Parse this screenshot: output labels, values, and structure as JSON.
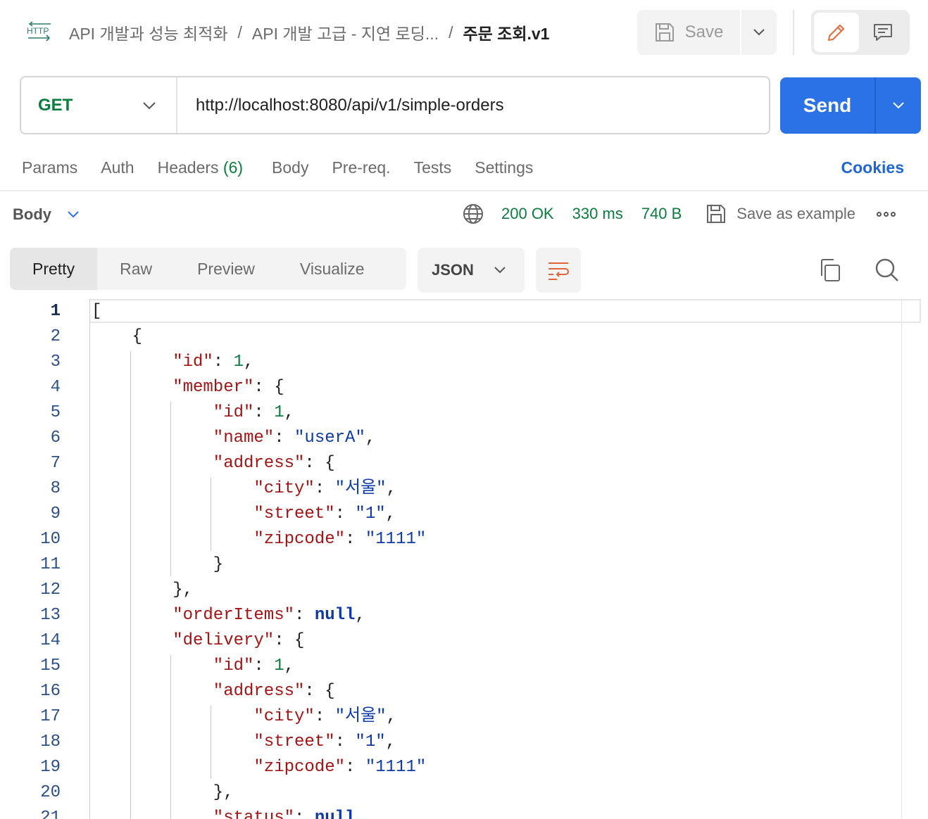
{
  "header": {
    "protocol_icon": "http-icon",
    "breadcrumbs": [
      "API 개발과 성능 최적화",
      "API 개발 고급 - 지연 로딩..."
    ],
    "separator": "/",
    "current": "주문 조회.v1",
    "save_label": "Save"
  },
  "request": {
    "method": "GET",
    "url": "http://localhost:8080/api/v1/simple-orders",
    "send_label": "Send"
  },
  "request_tabs": {
    "params": "Params",
    "auth": "Auth",
    "headers": "Headers",
    "headers_count": "(6)",
    "body": "Body",
    "prereq": "Pre-req.",
    "tests": "Tests",
    "settings": "Settings",
    "cookies": "Cookies"
  },
  "response": {
    "section_label": "Body",
    "status": "200 OK",
    "time": "330 ms",
    "size": "740 B",
    "save_example_label": "Save as example",
    "view_tabs": [
      "Pretty",
      "Raw",
      "Preview",
      "Visualize"
    ],
    "active_view": "Pretty",
    "format": "JSON"
  },
  "colors": {
    "accent_blue": "#2b72e6",
    "method_green": "#0b7d3e",
    "json_key": "#a31515",
    "json_string": "#0d3aa8",
    "json_number": "#0b7d3e"
  },
  "code_lines": [
    {
      "n": "1",
      "indent": 0,
      "parts": [
        [
          "p",
          "["
        ]
      ]
    },
    {
      "n": "2",
      "indent": 1,
      "parts": [
        [
          "p",
          "{"
        ]
      ]
    },
    {
      "n": "3",
      "indent": 2,
      "parts": [
        [
          "k",
          "\"id\""
        ],
        [
          "p",
          ": "
        ],
        [
          "n",
          "1"
        ],
        [
          "p",
          ","
        ]
      ]
    },
    {
      "n": "4",
      "indent": 2,
      "parts": [
        [
          "k",
          "\"member\""
        ],
        [
          "p",
          ": {"
        ]
      ]
    },
    {
      "n": "5",
      "indent": 3,
      "parts": [
        [
          "k",
          "\"id\""
        ],
        [
          "p",
          ": "
        ],
        [
          "n",
          "1"
        ],
        [
          "p",
          ","
        ]
      ]
    },
    {
      "n": "6",
      "indent": 3,
      "parts": [
        [
          "k",
          "\"name\""
        ],
        [
          "p",
          ": "
        ],
        [
          "s",
          "\"userA\""
        ],
        [
          "p",
          ","
        ]
      ]
    },
    {
      "n": "7",
      "indent": 3,
      "parts": [
        [
          "k",
          "\"address\""
        ],
        [
          "p",
          ": {"
        ]
      ]
    },
    {
      "n": "8",
      "indent": 4,
      "parts": [
        [
          "k",
          "\"city\""
        ],
        [
          "p",
          ": "
        ],
        [
          "s",
          "\"서울\""
        ],
        [
          "p",
          ","
        ]
      ]
    },
    {
      "n": "9",
      "indent": 4,
      "parts": [
        [
          "k",
          "\"street\""
        ],
        [
          "p",
          ": "
        ],
        [
          "s",
          "\"1\""
        ],
        [
          "p",
          ","
        ]
      ]
    },
    {
      "n": "10",
      "indent": 4,
      "parts": [
        [
          "k",
          "\"zipcode\""
        ],
        [
          "p",
          ": "
        ],
        [
          "s",
          "\"1111\""
        ]
      ]
    },
    {
      "n": "11",
      "indent": 3,
      "parts": [
        [
          "p",
          "}"
        ]
      ]
    },
    {
      "n": "12",
      "indent": 2,
      "parts": [
        [
          "p",
          "},"
        ]
      ]
    },
    {
      "n": "13",
      "indent": 2,
      "parts": [
        [
          "k",
          "\"orderItems\""
        ],
        [
          "p",
          ": "
        ],
        [
          "nl",
          "null"
        ],
        [
          "p",
          ","
        ]
      ]
    },
    {
      "n": "14",
      "indent": 2,
      "parts": [
        [
          "k",
          "\"delivery\""
        ],
        [
          "p",
          ": {"
        ]
      ]
    },
    {
      "n": "15",
      "indent": 3,
      "parts": [
        [
          "k",
          "\"id\""
        ],
        [
          "p",
          ": "
        ],
        [
          "n",
          "1"
        ],
        [
          "p",
          ","
        ]
      ]
    },
    {
      "n": "16",
      "indent": 3,
      "parts": [
        [
          "k",
          "\"address\""
        ],
        [
          "p",
          ": {"
        ]
      ]
    },
    {
      "n": "17",
      "indent": 4,
      "parts": [
        [
          "k",
          "\"city\""
        ],
        [
          "p",
          ": "
        ],
        [
          "s",
          "\"서울\""
        ],
        [
          "p",
          ","
        ]
      ]
    },
    {
      "n": "18",
      "indent": 4,
      "parts": [
        [
          "k",
          "\"street\""
        ],
        [
          "p",
          ": "
        ],
        [
          "s",
          "\"1\""
        ],
        [
          "p",
          ","
        ]
      ]
    },
    {
      "n": "19",
      "indent": 4,
      "parts": [
        [
          "k",
          "\"zipcode\""
        ],
        [
          "p",
          ": "
        ],
        [
          "s",
          "\"1111\""
        ]
      ]
    },
    {
      "n": "20",
      "indent": 3,
      "parts": [
        [
          "p",
          "},"
        ]
      ]
    },
    {
      "n": "21",
      "indent": 3,
      "parts": [
        [
          "k",
          "\"status\""
        ],
        [
          "p",
          ": "
        ],
        [
          "nl",
          "null"
        ]
      ]
    }
  ]
}
